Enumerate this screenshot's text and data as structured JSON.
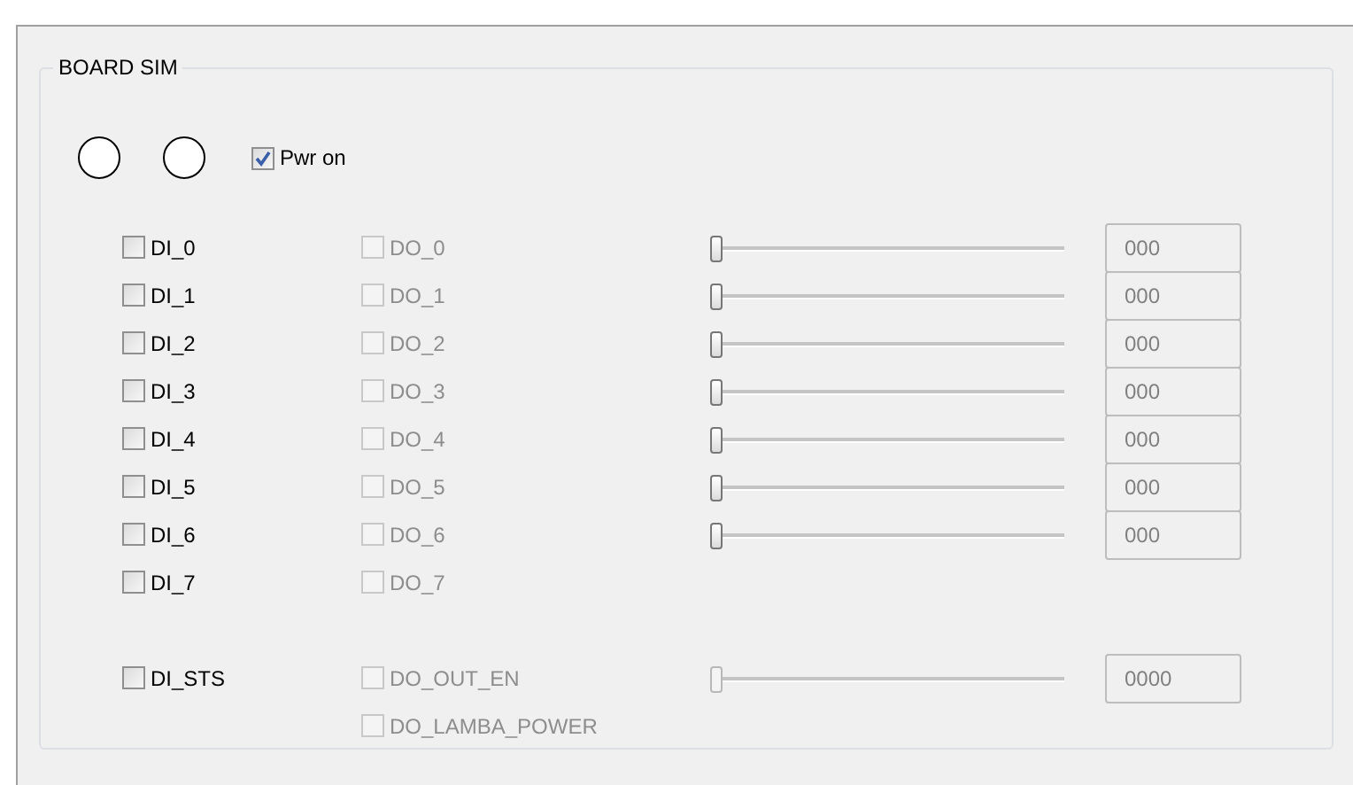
{
  "group": {
    "title": "BOARD SIM"
  },
  "leds": [
    {
      "on": false
    },
    {
      "on": false
    }
  ],
  "power": {
    "label": "Pwr on",
    "checked": true,
    "disabled": false
  },
  "rows": [
    {
      "di": {
        "label": "DI_0",
        "checked": false,
        "disabled": false
      },
      "do": {
        "label": "DO_0",
        "checked": false,
        "disabled": true
      },
      "slider": {
        "level": 0,
        "disabled": false
      },
      "reading": {
        "value": "000",
        "disabled": true
      }
    },
    {
      "di": {
        "label": "DI_1",
        "checked": false,
        "disabled": false
      },
      "do": {
        "label": "DO_1",
        "checked": false,
        "disabled": true
      },
      "slider": {
        "level": 0,
        "disabled": false
      },
      "reading": {
        "value": "000",
        "disabled": true
      }
    },
    {
      "di": {
        "label": "DI_2",
        "checked": false,
        "disabled": false
      },
      "do": {
        "label": "DO_2",
        "checked": false,
        "disabled": true
      },
      "slider": {
        "level": 0,
        "disabled": false
      },
      "reading": {
        "value": "000",
        "disabled": true
      }
    },
    {
      "di": {
        "label": "DI_3",
        "checked": false,
        "disabled": false
      },
      "do": {
        "label": "DO_3",
        "checked": false,
        "disabled": true
      },
      "slider": {
        "level": 0,
        "disabled": false
      },
      "reading": {
        "value": "000",
        "disabled": true
      }
    },
    {
      "di": {
        "label": "DI_4",
        "checked": false,
        "disabled": false
      },
      "do": {
        "label": "DO_4",
        "checked": false,
        "disabled": true
      },
      "slider": {
        "level": 0,
        "disabled": false
      },
      "reading": {
        "value": "000",
        "disabled": true
      }
    },
    {
      "di": {
        "label": "DI_5",
        "checked": false,
        "disabled": false
      },
      "do": {
        "label": "DO_5",
        "checked": false,
        "disabled": true
      },
      "slider": {
        "level": 0,
        "disabled": false
      },
      "reading": {
        "value": "000",
        "disabled": true
      }
    },
    {
      "di": {
        "label": "DI_6",
        "checked": false,
        "disabled": false
      },
      "do": {
        "label": "DO_6",
        "checked": false,
        "disabled": true
      },
      "slider": {
        "level": 0,
        "disabled": false
      },
      "reading": {
        "value": "000",
        "disabled": true
      }
    },
    {
      "di": {
        "label": "DI_7",
        "checked": false,
        "disabled": false
      },
      "do": {
        "label": "DO_7",
        "checked": false,
        "disabled": true
      }
    }
  ],
  "status_row": {
    "di": {
      "label": "DI_STS",
      "checked": false,
      "disabled": false
    },
    "do": {
      "label": "DO_OUT_EN",
      "checked": false,
      "disabled": true
    },
    "slider": {
      "level": 0,
      "disabled": true
    },
    "reading": {
      "value": "0000",
      "disabled": true
    }
  },
  "extra": {
    "do": {
      "label": "DO_LAMBA_POWER",
      "checked": false,
      "disabled": true
    }
  }
}
